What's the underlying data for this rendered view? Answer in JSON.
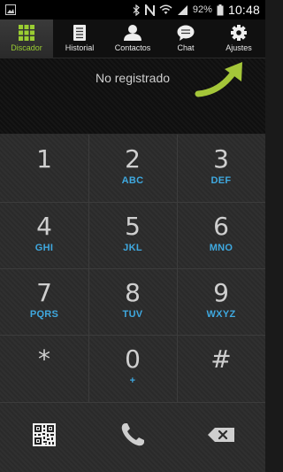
{
  "status_bar": {
    "battery_text": "92%",
    "time": "10:48",
    "icons": [
      "image-icon",
      "bluetooth-icon",
      "nfc-icon",
      "wifi-icon",
      "signal-icon",
      "battery-icon"
    ]
  },
  "tabs": [
    {
      "label": "Discador",
      "icon": "dialpad-icon",
      "active": true
    },
    {
      "label": "Historial",
      "icon": "list-icon",
      "active": false
    },
    {
      "label": "Contactos",
      "icon": "person-icon",
      "active": false
    },
    {
      "label": "Chat",
      "icon": "chat-bubble-icon",
      "active": false
    },
    {
      "label": "Ajustes",
      "icon": "gear-icon",
      "active": false
    }
  ],
  "registration_status": "No registrado",
  "accent_color": "#9acd32",
  "keys": [
    {
      "digit": "1",
      "letters": ""
    },
    {
      "digit": "2",
      "letters": "ABC"
    },
    {
      "digit": "3",
      "letters": "DEF"
    },
    {
      "digit": "4",
      "letters": "GHI"
    },
    {
      "digit": "5",
      "letters": "JKL"
    },
    {
      "digit": "6",
      "letters": "MNO"
    },
    {
      "digit": "7",
      "letters": "PQRS"
    },
    {
      "digit": "8",
      "letters": "TUV"
    },
    {
      "digit": "9",
      "letters": "WXYZ"
    },
    {
      "digit": "*",
      "letters": ""
    },
    {
      "digit": "0",
      "letters": "+"
    },
    {
      "digit": "#",
      "letters": ""
    }
  ],
  "bottom_actions": [
    "qr-code-icon",
    "phone-call-icon",
    "backspace-icon"
  ]
}
